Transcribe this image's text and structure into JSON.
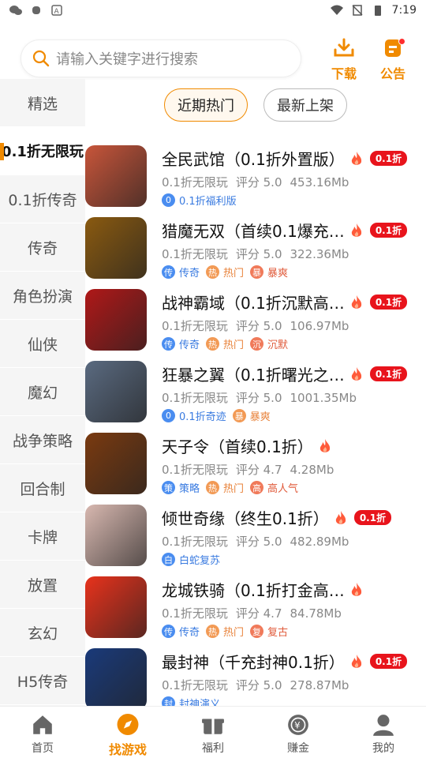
{
  "status_bar": {
    "time": "7:19",
    "icons": [
      "wechat-icon",
      "bug-icon",
      "font-icon",
      "wifi-icon",
      "no-sim-icon",
      "battery-icon"
    ]
  },
  "search": {
    "placeholder": "请输入关键字进行搜索"
  },
  "header": {
    "download_label": "下载",
    "notice_label": "公告"
  },
  "sidebar": {
    "items": [
      {
        "label": "精选"
      },
      {
        "label": "0.1折无限玩",
        "active": true
      },
      {
        "label": "0.1折传奇"
      },
      {
        "label": "传奇"
      },
      {
        "label": "角色扮演"
      },
      {
        "label": "仙侠"
      },
      {
        "label": "魔幻"
      },
      {
        "label": "战争策略"
      },
      {
        "label": "回合制"
      },
      {
        "label": "卡牌"
      },
      {
        "label": "放置"
      },
      {
        "label": "玄幻"
      },
      {
        "label": "H5传奇"
      }
    ]
  },
  "tabs": [
    {
      "label": "近期热门",
      "active": true
    },
    {
      "label": "最新上架"
    }
  ],
  "games": [
    {
      "name": "全民武馆（0.1折外置版）",
      "badge": "0.1折",
      "type": "0.1折无限玩",
      "rating": "评分 5.0",
      "size": "453.16Mb",
      "tags": [
        {
          "glyph": "0",
          "text": "0.1折福利版",
          "color": "blue"
        }
      ]
    },
    {
      "name": "猎魔无双（首续0.1爆充…",
      "badge": "0.1折",
      "type": "0.1折无限玩",
      "rating": "评分 5.0",
      "size": "322.36Mb",
      "tags": [
        {
          "glyph": "传",
          "text": "传奇",
          "color": "blue"
        },
        {
          "glyph": "热",
          "text": "热门",
          "color": "orange"
        },
        {
          "glyph": "暴",
          "text": "暴爽",
          "color": "red"
        }
      ]
    },
    {
      "name": "战神霸域（0.1折沉默高…",
      "badge": "0.1折",
      "type": "0.1折无限玩",
      "rating": "评分 5.0",
      "size": "106.97Mb",
      "tags": [
        {
          "glyph": "传",
          "text": "传奇",
          "color": "blue"
        },
        {
          "glyph": "热",
          "text": "热门",
          "color": "orange"
        },
        {
          "glyph": "沉",
          "text": "沉默",
          "color": "red"
        }
      ]
    },
    {
      "name": "狂暴之翼（0.1折曙光之…",
      "badge": "0.1折",
      "type": "0.1折无限玩",
      "rating": "评分 5.0",
      "size": "1001.35Mb",
      "tags": [
        {
          "glyph": "0",
          "text": "0.1折奇迹",
          "color": "blue"
        },
        {
          "glyph": "暴",
          "text": "暴爽",
          "color": "orange"
        }
      ]
    },
    {
      "name": "天子令（首续0.1折）",
      "badge": "",
      "type": "0.1折无限玩",
      "rating": "评分 4.7",
      "size": "4.28Mb",
      "tags": [
        {
          "glyph": "策",
          "text": "策略",
          "color": "blue"
        },
        {
          "glyph": "热",
          "text": "热门",
          "color": "orange"
        },
        {
          "glyph": "高",
          "text": "高人气",
          "color": "red"
        }
      ]
    },
    {
      "name": "倾世奇缘（终生0.1折）",
      "badge": "0.1折",
      "type": "0.1折无限玩",
      "rating": "评分 5.0",
      "size": "482.89Mb",
      "tags": [
        {
          "glyph": "白",
          "text": "白蛇复苏",
          "color": "blue"
        }
      ]
    },
    {
      "name": "龙城铁骑（0.1折打金高…",
      "badge": "",
      "type": "0.1折无限玩",
      "rating": "评分 4.7",
      "size": "84.78Mb",
      "tags": [
        {
          "glyph": "传",
          "text": "传奇",
          "color": "blue"
        },
        {
          "glyph": "热",
          "text": "热门",
          "color": "orange"
        },
        {
          "glyph": "复",
          "text": "复古",
          "color": "red"
        }
      ]
    },
    {
      "name": "最封神（千充封神0.1折）",
      "badge": "0.1折",
      "type": "0.1折无限玩",
      "rating": "评分 5.0",
      "size": "278.87Mb",
      "tags": [
        {
          "glyph": "封",
          "text": "封神演义",
          "color": "blue"
        }
      ]
    }
  ],
  "thumb_colors": [
    "#c8553a",
    "#8a5a10",
    "#b01818",
    "#5a6a80",
    "#7a3a10",
    "#d8b8b0",
    "#e8321c",
    "#1a3a7a"
  ],
  "bottom_nav": [
    {
      "label": "首页",
      "icon": "home-icon"
    },
    {
      "label": "找游戏",
      "icon": "compass-icon",
      "active": true
    },
    {
      "label": "福利",
      "icon": "gift-icon"
    },
    {
      "label": "赚金",
      "icon": "coin-icon"
    },
    {
      "label": "我的",
      "icon": "user-icon"
    }
  ],
  "colors": {
    "accent": "#f08a00",
    "badge_red": "#e8141c"
  }
}
